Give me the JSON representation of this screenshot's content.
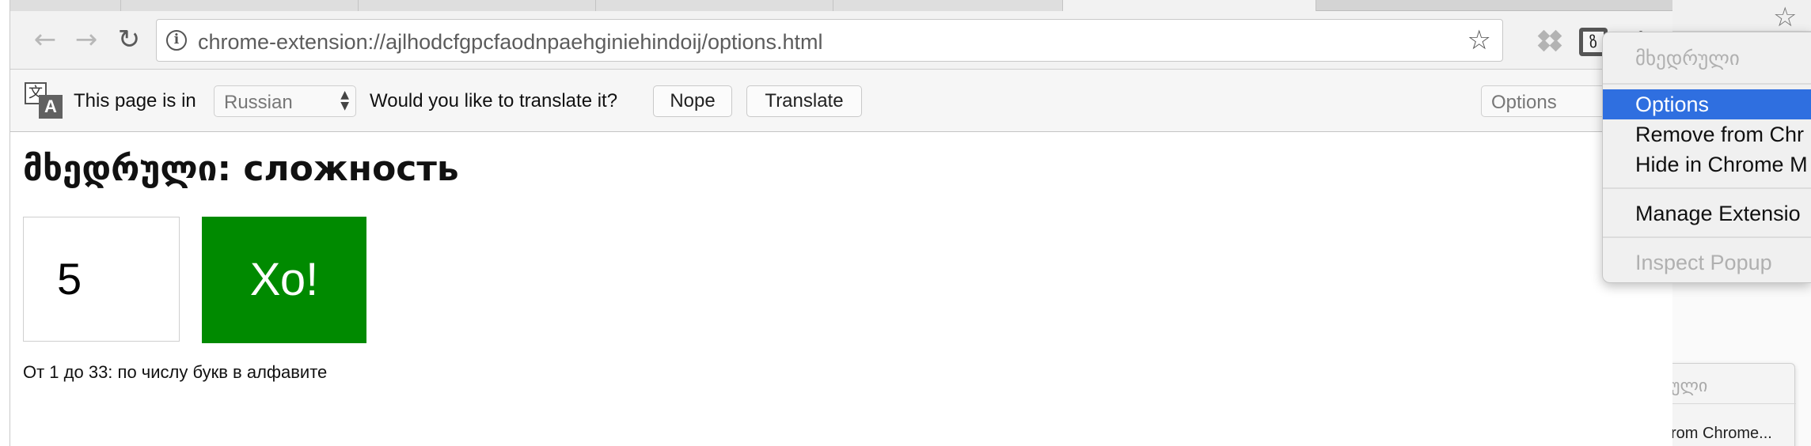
{
  "browser": {
    "url": "chrome-extension://ajlhodcfgpcfaodnpaehginiehindoij/options.html"
  },
  "translate_bar": {
    "prefix": "This page is in",
    "language": "Russian",
    "question": "Would you like to translate it?",
    "nope_label": "Nope",
    "translate_label": "Translate",
    "options_label": "Options"
  },
  "page": {
    "title": "მხედრული: сложность",
    "difficulty_value": "5",
    "go_label": "Хо!",
    "hint": "От 1 до 33: по числу букв в алфавите",
    "go_color": "#008a00"
  },
  "extension_menu": {
    "items": [
      {
        "label": "მხედრული",
        "state": "disabled"
      },
      {
        "label": "Options",
        "state": "selected"
      },
      {
        "label": "Remove from Chr",
        "state": "normal"
      },
      {
        "label": "Hide in Chrome M",
        "state": "normal"
      },
      {
        "label": "Manage Extensio",
        "state": "normal"
      },
      {
        "label": "Inspect Popup",
        "state": "disabled"
      }
    ],
    "highlight_color": "#2f6fe0"
  },
  "background_window": {
    "popup_title": "ული",
    "popup_item": "rom Chrome..."
  }
}
